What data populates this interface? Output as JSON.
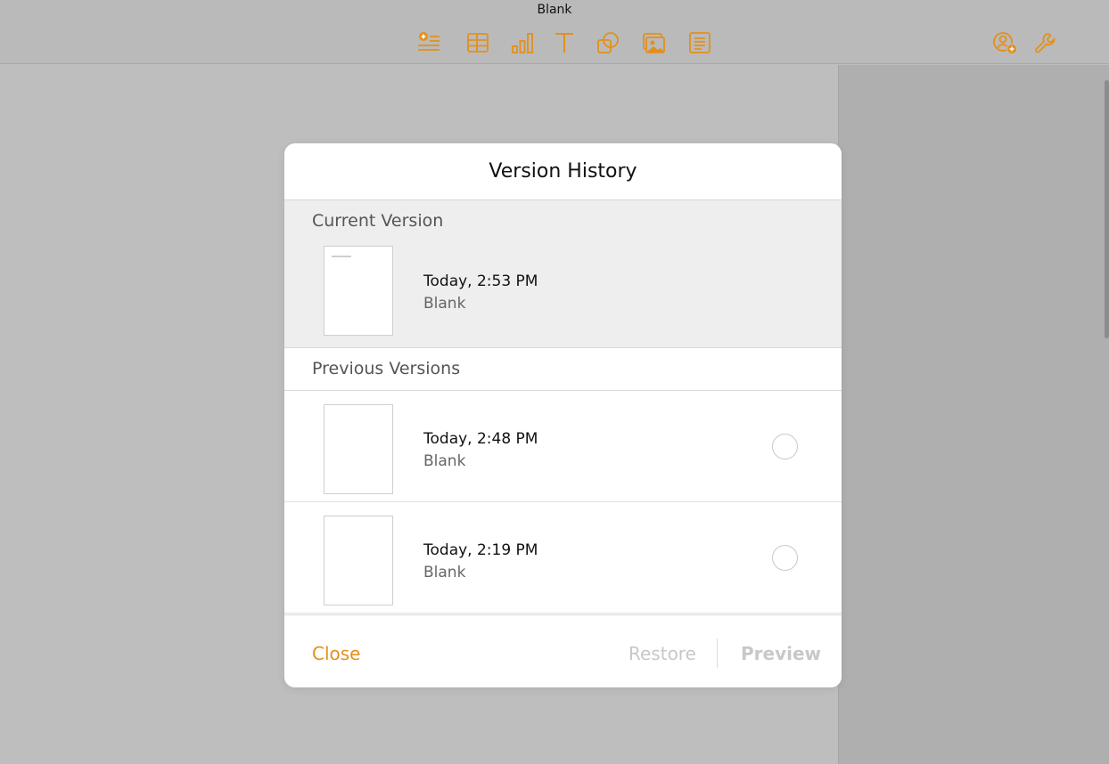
{
  "window": {
    "title": "Blank"
  },
  "toolbar": {
    "tools": [
      {
        "name": "insert-icon"
      },
      {
        "name": "table-icon"
      },
      {
        "name": "chart-icon"
      },
      {
        "name": "text-icon"
      },
      {
        "name": "shape-icon"
      },
      {
        "name": "media-icon"
      },
      {
        "name": "comment-icon"
      }
    ],
    "right_tools": [
      {
        "name": "collaborate-icon"
      },
      {
        "name": "wrench-icon"
      }
    ],
    "accent_color": "#e3901b"
  },
  "dialog": {
    "title": "Version History",
    "current_section_label": "Current Version",
    "current": {
      "time": "Today, 2:53 PM",
      "name": "Blank"
    },
    "previous_section_label": "Previous Versions",
    "previous": [
      {
        "time": "Today, 2:48 PM",
        "name": "Blank"
      },
      {
        "time": "Today, 2:19 PM",
        "name": "Blank"
      }
    ],
    "buttons": {
      "close": "Close",
      "restore": "Restore",
      "preview": "Preview"
    }
  }
}
